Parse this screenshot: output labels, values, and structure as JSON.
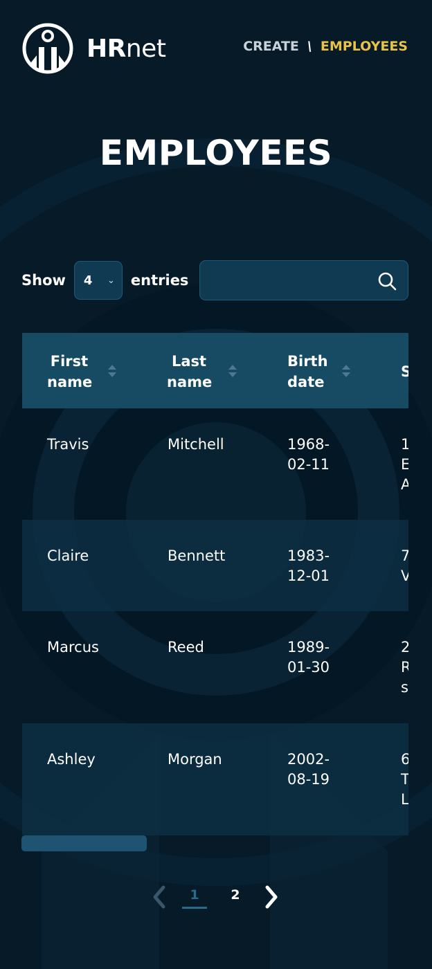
{
  "header": {
    "logo_text_bold": "HR",
    "logo_text_light": "net",
    "nav": {
      "create": "CREATE",
      "separator": "\\",
      "employees": "EMPLOYEES"
    }
  },
  "page_title": "EMPLOYEES",
  "controls": {
    "show_label": "Show",
    "entries_value": "4",
    "entries_label": "entries",
    "search_value": "",
    "search_placeholder": ""
  },
  "table": {
    "columns": [
      {
        "line1": "First",
        "line2": "name"
      },
      {
        "line1": "Last",
        "line2": "name"
      },
      {
        "line1": "Birth",
        "line2": "date"
      },
      {
        "line1": "S",
        "line2": ""
      }
    ],
    "rows": [
      {
        "first": "Travis",
        "last": "Mitchell",
        "birth1": "1968-",
        "birth2": "02-11",
        "street": [
          "1",
          "E",
          "A"
        ]
      },
      {
        "first": "Claire",
        "last": "Bennett",
        "birth1": "1983-",
        "birth2": "12-01",
        "street": [
          "7",
          "V"
        ]
      },
      {
        "first": "Marcus",
        "last": "Reed",
        "birth1": "1989-",
        "birth2": "01-30",
        "street": [
          "2",
          "R",
          "s"
        ]
      },
      {
        "first": "Ashley",
        "last": "Morgan",
        "birth1": "2002-",
        "birth2": "08-19",
        "street": [
          "6",
          "T",
          "L"
        ]
      }
    ]
  },
  "pagination": {
    "pages": [
      "1",
      "2"
    ],
    "current": "1"
  },
  "colors": {
    "background": "#061a28",
    "accent": "#e9c24a",
    "header_row": "#174a63",
    "input_bg": "#103a52"
  }
}
